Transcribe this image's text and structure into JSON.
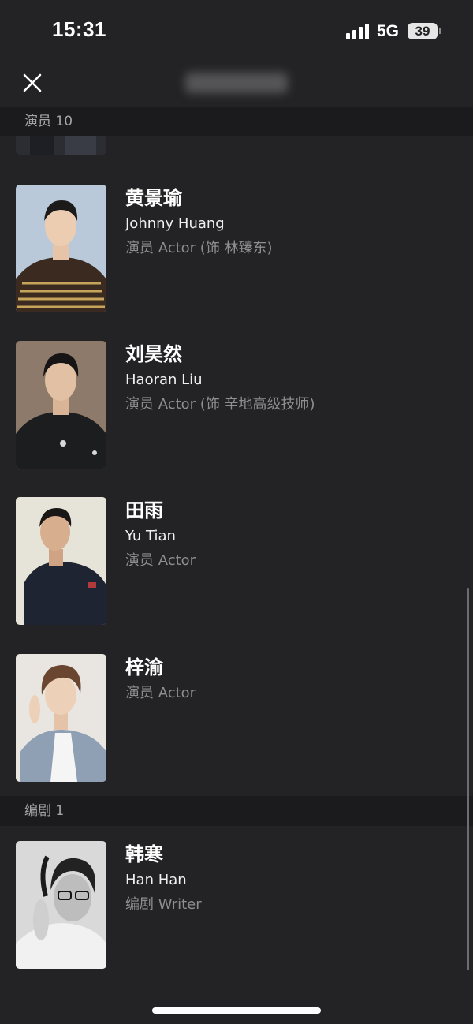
{
  "status_bar": {
    "time": "15:31",
    "network": "5G",
    "battery": "39"
  },
  "nav": {
    "close_icon": "close-icon"
  },
  "sections": [
    {
      "title": "演员 10",
      "people": [
        {
          "name": "黄景瑜",
          "english_name": "Johnny Huang",
          "role": "演员 Actor (饰 林臻东)"
        },
        {
          "name": "刘昊然",
          "english_name": "Haoran Liu",
          "role": "演员 Actor (饰 辛地高级技师)"
        },
        {
          "name": "田雨",
          "english_name": "Yu Tian",
          "role": "演员 Actor"
        },
        {
          "name": "梓渝",
          "english_name": "",
          "role": "演员 Actor"
        }
      ]
    },
    {
      "title": "编剧 1",
      "people": [
        {
          "name": "韩寒",
          "english_name": "Han Han",
          "role": "编剧 Writer"
        }
      ]
    }
  ],
  "colors": {
    "background": "#232325",
    "section_header_bg": "#1b1b1d",
    "text_primary": "#ffffff",
    "text_secondary": "#8e8e92"
  }
}
